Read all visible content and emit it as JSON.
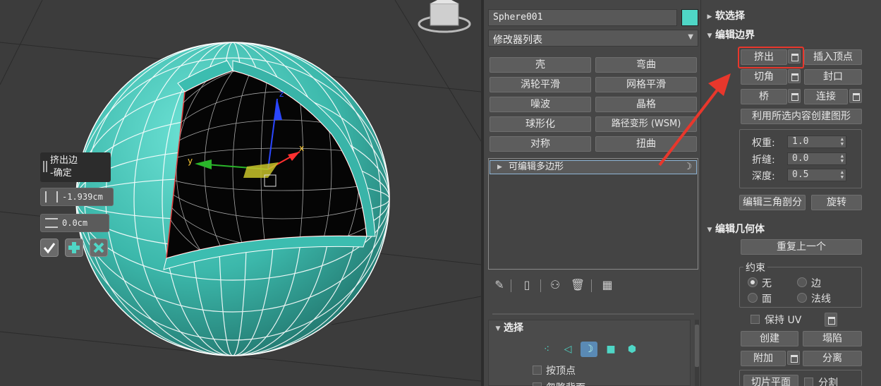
{
  "caddy": {
    "title_line1": "挤出边",
    "title_line2": "-确定",
    "height_value": "-1.939cm",
    "width_value": "0.0cm"
  },
  "axes": {
    "x": "x",
    "y": "y",
    "z": "z"
  },
  "modifier_panel": {
    "object_name": "Sphere001",
    "object_color": "#4fd6c6",
    "modifier_list_label": "修改器列表",
    "modifier_buttons": [
      "壳",
      "弯曲",
      "涡轮平滑",
      "网格平滑",
      "噪波",
      "晶格",
      "球形化",
      "路径变形 (WSM)",
      "对称",
      "扭曲"
    ],
    "stack_item": "可编辑多边形",
    "selection_header": "选择",
    "by_vertex": "按顶点",
    "ignore_backface": "忽略背面"
  },
  "right_panel": {
    "soft_selection": "软选择",
    "edit_borders": "编辑边界",
    "extrude": "挤出",
    "insert_vertex": "插入顶点",
    "chamfer": "切角",
    "cap": "封口",
    "bridge": "桥",
    "connect": "连接",
    "create_shape": "利用所选内容创建图形",
    "weight_label": "权重:",
    "weight_value": "1.0",
    "crease_label": "折缝:",
    "crease_value": "0.0",
    "depth_label": "深度:",
    "depth_value": "0.5",
    "edit_tri": "编辑三角剖分",
    "turn": "旋转",
    "edit_geometry": "编辑几何体",
    "repeat_last": "重复上一个",
    "constraints": "约束",
    "none": "无",
    "edge": "边",
    "face": "面",
    "normal": "法线",
    "preserve_uv": "保持 UV",
    "create": "创建",
    "collapse": "塌陷",
    "attach": "附加",
    "detach": "分离",
    "slice_plane": "切片平面",
    "split": "分割"
  },
  "colors": {
    "accent": "#4fd6c6",
    "highlight": "#e8372c"
  }
}
